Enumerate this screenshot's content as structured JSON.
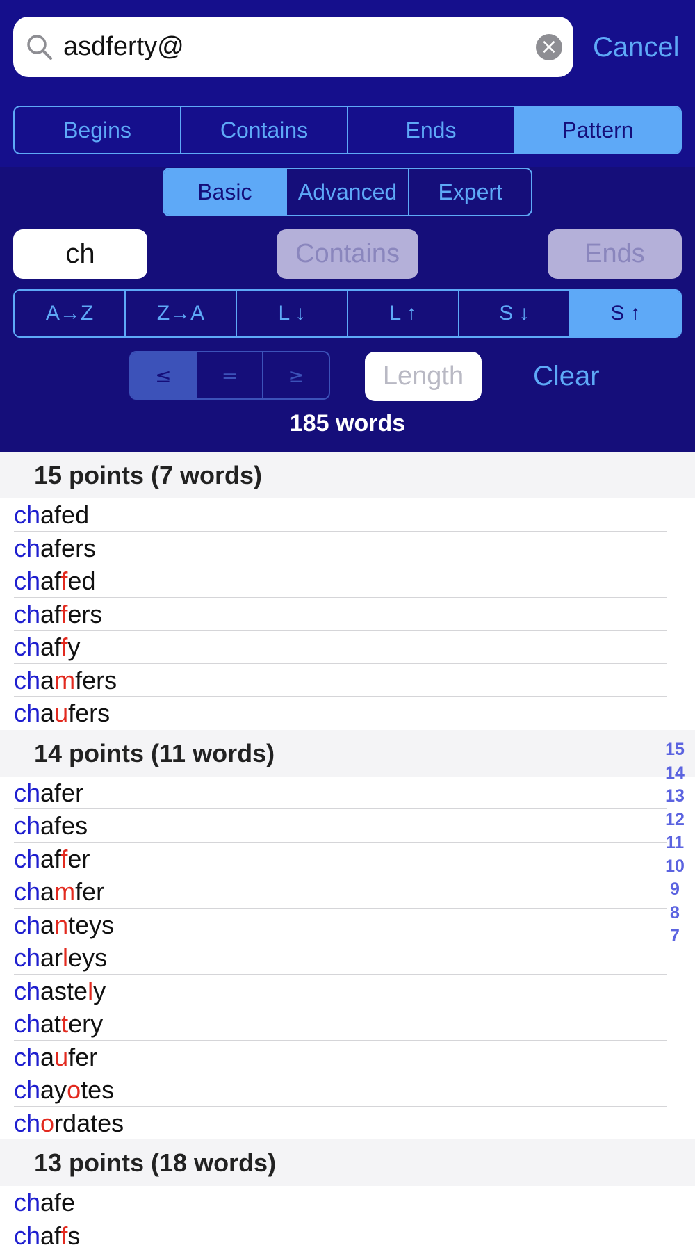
{
  "search": {
    "query": "asdferty@",
    "cancel_label": "Cancel"
  },
  "modes": {
    "items": [
      "Begins",
      "Contains",
      "Ends",
      "Pattern"
    ],
    "selected": "Pattern"
  },
  "levels": {
    "items": [
      "Basic",
      "Advanced",
      "Expert"
    ],
    "selected": "Basic"
  },
  "pattern": {
    "begins_value": "ch",
    "contains_placeholder": "Contains",
    "ends_placeholder": "Ends"
  },
  "sorts": {
    "items": [
      "A→Z",
      "Z→A",
      "L ↓",
      "L ↑",
      "S ↓",
      "S ↑"
    ],
    "selected": "S ↑"
  },
  "length_filter": {
    "comparators": [
      "≤",
      "=",
      "≥"
    ],
    "selected": "≤",
    "length_placeholder": "Length",
    "clear_label": "Clear"
  },
  "word_count": "185 words",
  "sections": [
    {
      "title": "15 points (7 words)",
      "words": [
        {
          "prefix": "ch",
          "parts": [
            {
              "t": "afed",
              "w": false
            }
          ]
        },
        {
          "prefix": "ch",
          "parts": [
            {
              "t": "afers",
              "w": false
            }
          ]
        },
        {
          "prefix": "ch",
          "parts": [
            {
              "t": "af",
              "w": false
            },
            {
              "t": "f",
              "w": true
            },
            {
              "t": "ed",
              "w": false
            }
          ]
        },
        {
          "prefix": "ch",
          "parts": [
            {
              "t": "af",
              "w": false
            },
            {
              "t": "f",
              "w": true
            },
            {
              "t": "ers",
              "w": false
            }
          ]
        },
        {
          "prefix": "ch",
          "parts": [
            {
              "t": "af",
              "w": false
            },
            {
              "t": "f",
              "w": true
            },
            {
              "t": "y",
              "w": false
            }
          ]
        },
        {
          "prefix": "ch",
          "parts": [
            {
              "t": "a",
              "w": false
            },
            {
              "t": "m",
              "w": true
            },
            {
              "t": "fers",
              "w": false
            }
          ]
        },
        {
          "prefix": "ch",
          "parts": [
            {
              "t": "a",
              "w": false
            },
            {
              "t": "u",
              "w": true
            },
            {
              "t": "fers",
              "w": false
            }
          ]
        }
      ]
    },
    {
      "title": "14 points (11 words)",
      "words": [
        {
          "prefix": "ch",
          "parts": [
            {
              "t": "afer",
              "w": false
            }
          ]
        },
        {
          "prefix": "ch",
          "parts": [
            {
              "t": "afes",
              "w": false
            }
          ]
        },
        {
          "prefix": "ch",
          "parts": [
            {
              "t": "af",
              "w": false
            },
            {
              "t": "f",
              "w": true
            },
            {
              "t": "er",
              "w": false
            }
          ]
        },
        {
          "prefix": "ch",
          "parts": [
            {
              "t": "a",
              "w": false
            },
            {
              "t": "m",
              "w": true
            },
            {
              "t": "fer",
              "w": false
            }
          ]
        },
        {
          "prefix": "ch",
          "parts": [
            {
              "t": "a",
              "w": false
            },
            {
              "t": "n",
              "w": true
            },
            {
              "t": "teys",
              "w": false
            }
          ]
        },
        {
          "prefix": "ch",
          "parts": [
            {
              "t": "ar",
              "w": false
            },
            {
              "t": "l",
              "w": true
            },
            {
              "t": "eys",
              "w": false
            }
          ]
        },
        {
          "prefix": "ch",
          "parts": [
            {
              "t": "aste",
              "w": false
            },
            {
              "t": "l",
              "w": true
            },
            {
              "t": "y",
              "w": false
            }
          ]
        },
        {
          "prefix": "ch",
          "parts": [
            {
              "t": "at",
              "w": false
            },
            {
              "t": "t",
              "w": true
            },
            {
              "t": "ery",
              "w": false
            }
          ]
        },
        {
          "prefix": "ch",
          "parts": [
            {
              "t": "a",
              "w": false
            },
            {
              "t": "u",
              "w": true
            },
            {
              "t": "fer",
              "w": false
            }
          ]
        },
        {
          "prefix": "ch",
          "parts": [
            {
              "t": "ay",
              "w": false
            },
            {
              "t": "o",
              "w": true
            },
            {
              "t": "tes",
              "w": false
            }
          ]
        },
        {
          "prefix": "ch",
          "parts": [
            {
              "t": "o",
              "w": true
            },
            {
              "t": "rdates",
              "w": false
            }
          ]
        }
      ]
    },
    {
      "title": "13 points (18 words)",
      "words": [
        {
          "prefix": "ch",
          "parts": [
            {
              "t": "afe",
              "w": false
            }
          ]
        },
        {
          "prefix": "ch",
          "parts": [
            {
              "t": "af",
              "w": false
            },
            {
              "t": "f",
              "w": true
            },
            {
              "t": "s",
              "w": false
            }
          ]
        }
      ]
    }
  ],
  "section_index": [
    "15",
    "14",
    "13",
    "12",
    "11",
    "10",
    "9",
    "8",
    "7"
  ],
  "colors": {
    "header_bg": "#150e7a",
    "accent": "#5ea9f7",
    "prefix": "#1f1fcf",
    "wildcard": "#e22a1f",
    "index": "#5b63e0"
  }
}
